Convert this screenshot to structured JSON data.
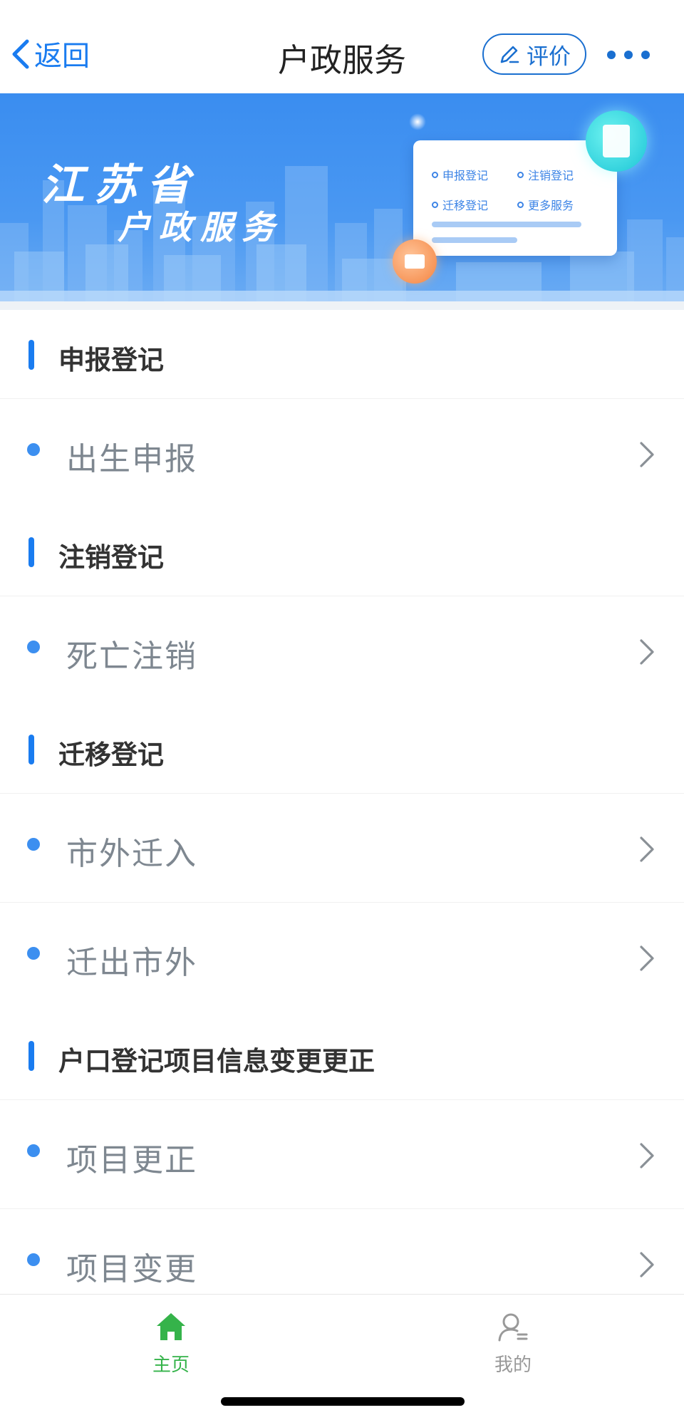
{
  "nav": {
    "back_label": "返回",
    "title": "户政服务",
    "rate_label": "评价"
  },
  "banner": {
    "line1": "江苏省",
    "line2": "户政服务",
    "card_items": [
      "申报登记",
      "注销登记",
      "迁移登记",
      "更多服务"
    ]
  },
  "sections": [
    {
      "header": "申报登记",
      "items": [
        "出生申报"
      ]
    },
    {
      "header": "注销登记",
      "items": [
        "死亡注销"
      ]
    },
    {
      "header": "迁移登记",
      "items": [
        "市外迁入",
        "迁出市外"
      ]
    },
    {
      "header": "户口登记项目信息变更更正",
      "items": [
        "项目更正",
        "项目变更"
      ]
    }
  ],
  "tabbar": {
    "home_label": "主页",
    "mine_label": "我的",
    "active": "home"
  },
  "colors": {
    "accent": "#1a7cf0",
    "active_tab": "#35b34a",
    "item_text": "#7e8790"
  }
}
